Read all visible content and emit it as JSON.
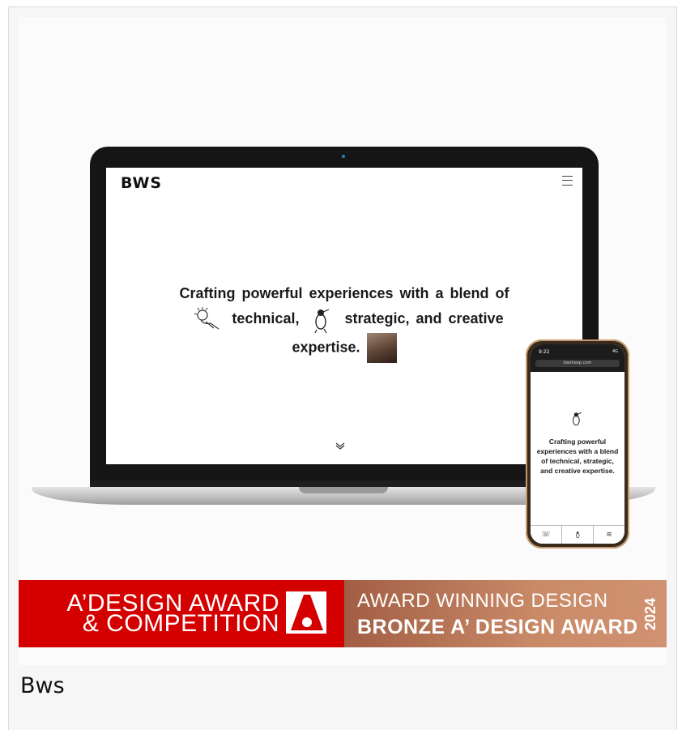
{
  "laptop": {
    "logo": "BWS",
    "headline_line1": "Crafting powerful experiences with a blend of",
    "headline_line2a": "technical,",
    "headline_line2b": "strategic, and creative",
    "headline_line3": "expertise."
  },
  "phone": {
    "time": "9:22",
    "status": "4G",
    "url": "bwsheep.com",
    "headline": "Crafting powerful experiences with a blend of technical, strategic, and creative expertise."
  },
  "award": {
    "left_line1": "A’DESIGN AWARD",
    "left_line2": "& COMPETITION",
    "right_line1": "AWARD WINNING DESIGN",
    "right_line2": "BRONZE A’ DESIGN AWARD",
    "year": "2024",
    "colors": {
      "red": "#d40000",
      "bronze": "#c98a68"
    }
  },
  "caption": "Bws",
  "icons": [
    "hamburger-menu-icon",
    "lightbulb-hand-doodle-icon",
    "bird-doodle-icon",
    "chevron-down-icon",
    "whatsapp-icon",
    "menu-icon",
    "a-design-award-logo-icon"
  ]
}
